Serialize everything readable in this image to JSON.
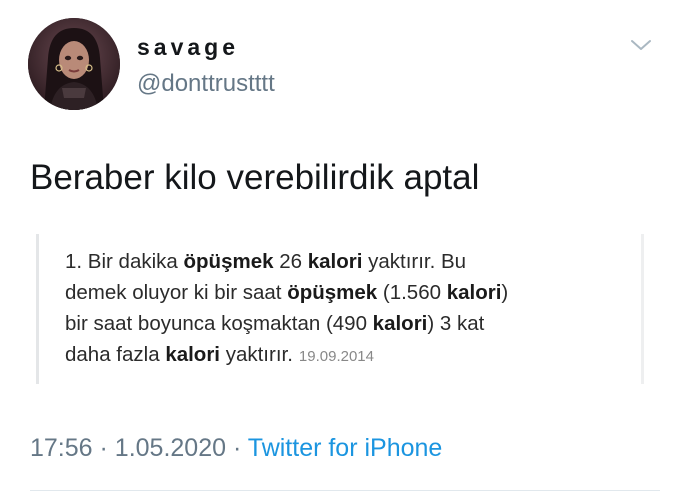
{
  "user": {
    "display_name": "savage",
    "handle": "@donttrustttt"
  },
  "icons": {
    "avatar": "profile-avatar",
    "caret": "chevron-down-icon"
  },
  "tweet": {
    "text": "Beraber kilo verebilirdik aptal"
  },
  "quote": {
    "line1": {
      "t1": "1. Bir dakika ",
      "b1": "öpüşmek",
      "t2": " 26 ",
      "b2": "kalori",
      "t3": " yaktırır. Bu"
    },
    "line2": {
      "t1": "demek oluyor ki bir saat ",
      "b1": "öpüşmek",
      "t2": " (1.560 ",
      "b2": "kalori",
      "t3": ")"
    },
    "line3": {
      "t1": "bir saat boyunca koşmaktan (490 ",
      "b1": "kalori",
      "t2": ") 3 kat"
    },
    "line4": {
      "t1": "daha fazla ",
      "b1": "kalori",
      "t2": " yaktırır."
    },
    "date": "19.09.2014"
  },
  "meta": {
    "time": "17:56",
    "separator": "·",
    "date": "1.05.2020",
    "source": "Twitter for iPhone"
  },
  "colors": {
    "text": "#14171a",
    "secondary": "#657786",
    "link": "#1b95e0",
    "divider": "#e1e8ed"
  }
}
